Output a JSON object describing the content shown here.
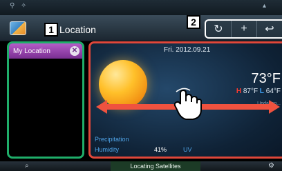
{
  "title": "Location",
  "callouts": [
    "1",
    "2"
  ],
  "toolbar": [
    {
      "icon": "refresh-icon",
      "glyph": "↻"
    },
    {
      "icon": "add-icon",
      "glyph": "+"
    },
    {
      "icon": "back-icon",
      "glyph": "↩"
    }
  ],
  "sidebar": {
    "items": [
      {
        "label": "My Location"
      }
    ]
  },
  "weather": {
    "date": "Fri. 2012.09.21",
    "temperature": "73°F",
    "high_label": "H",
    "high": "87°F",
    "low_label": "L",
    "low": "64°F",
    "updating": "Updating...",
    "precipitation_label": "Precipitation",
    "humidity_label": "Humidity",
    "humidity_value": "41%",
    "uv_label": "UV"
  },
  "bottom": {
    "status": "Locating Satellites"
  },
  "colors": {
    "accent_green": "#1fae6a",
    "accent_red": "#e0473a",
    "location_purple": "#9a44b0"
  }
}
